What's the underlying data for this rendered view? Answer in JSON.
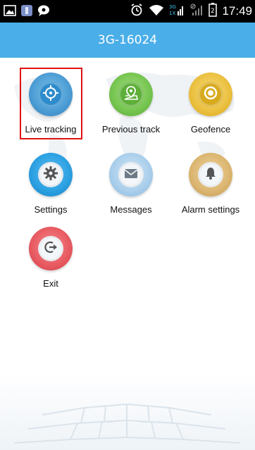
{
  "status_bar": {
    "time": "17:49",
    "icons_left": [
      "image-icon",
      "app-icon",
      "chat-icon"
    ],
    "icons_right": [
      "alarm-icon",
      "wifi-icon",
      "signal-3g-icon",
      "signal-icon",
      "battery-icon"
    ]
  },
  "title_bar": {
    "title": "3G-16024"
  },
  "menu": {
    "items": [
      {
        "label": "Live tracking",
        "icon": "crosshair-icon",
        "color": "#3d8fc8",
        "selected": true
      },
      {
        "label": "Previous track",
        "icon": "map-pin-icon",
        "color": "#6cbe47",
        "selected": false
      },
      {
        "label": "Geofence",
        "icon": "target-icon",
        "color": "#e7bb2c",
        "selected": false
      },
      {
        "label": "Settings",
        "icon": "gear-icon",
        "color": "#2599dc",
        "selected": false
      },
      {
        "label": "Messages",
        "icon": "envelope-icon",
        "color": "#9fc6e6",
        "selected": false
      },
      {
        "label": "Alarm settings",
        "icon": "bell-icon",
        "color": "#d9b56a",
        "selected": false
      },
      {
        "label": "Exit",
        "icon": "exit-icon",
        "color": "#e8545b",
        "selected": false
      }
    ]
  },
  "colors": {
    "title_bar": "#4aaee9",
    "selection_border": "#e01010"
  }
}
